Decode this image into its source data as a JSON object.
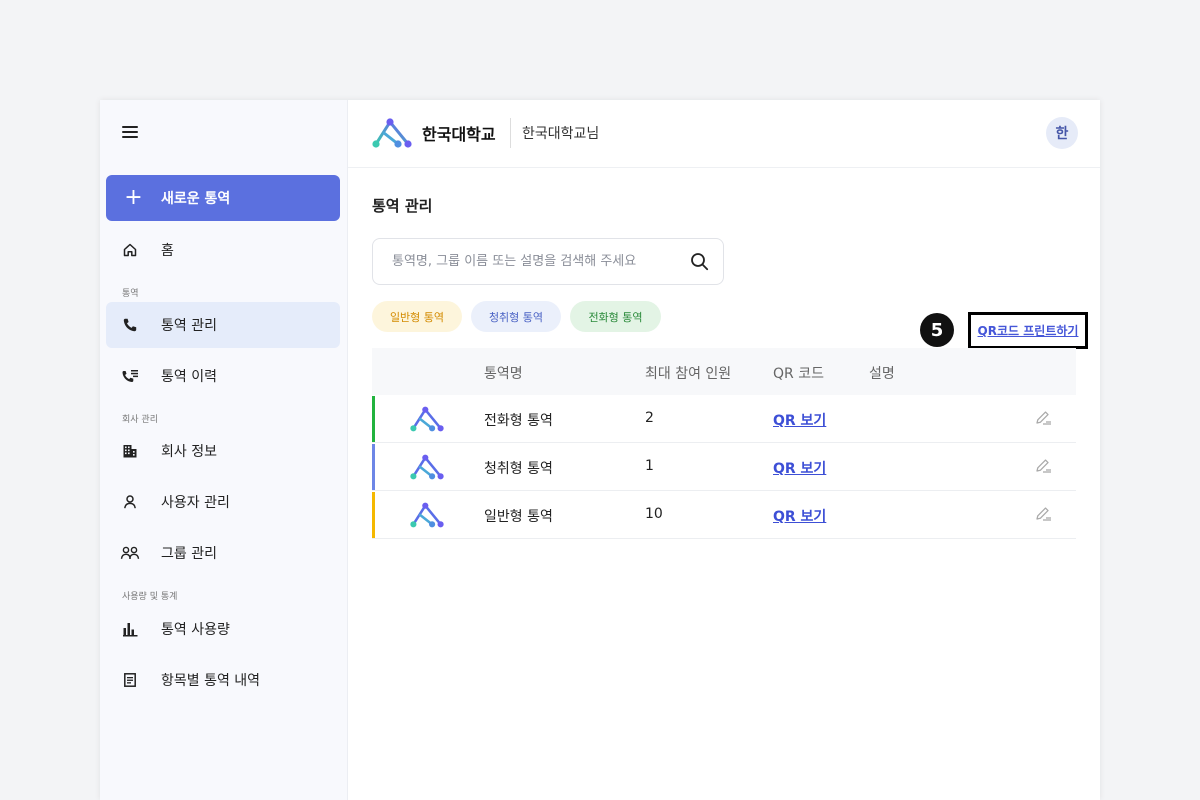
{
  "sidebar": {
    "new_call": "새로운 통역",
    "home": "홈",
    "section_call": "통역",
    "call_manage": "통역 관리",
    "call_history": "통역 이력",
    "section_company": "회사 관리",
    "company_info": "회사 정보",
    "user_manage": "사용자 관리",
    "group_manage": "그룹 관리",
    "section_usage": "사용량 및 통계",
    "usage": "통역 사용량",
    "itemized": "항목별 통역 내역"
  },
  "header": {
    "org_name": "한국대학교",
    "user_name": "한국대학교님",
    "avatar": "한"
  },
  "main": {
    "title": "통역 관리",
    "search_placeholder": "통역명, 그룹 이름 또는 설명을 검색해 주세요",
    "search_value": "",
    "chips": {
      "general": "일반형 통역",
      "listen": "청취형 통역",
      "phone": "전화형 통역"
    },
    "step_badge": "5",
    "qr_print": "QR코드 프린트하기",
    "table": {
      "headers": {
        "name": "통역명",
        "max": "최대 참여 인원",
        "qr": "QR 코드",
        "desc": "설명"
      },
      "rows": [
        {
          "name": "전화형 통역",
          "max": "2",
          "qr": "QR 보기",
          "desc": "",
          "color": "#22b33e"
        },
        {
          "name": "청취형 통역",
          "max": "1",
          "qr": "QR 보기",
          "desc": "",
          "color": "#6d86e6"
        },
        {
          "name": "일반형 통역",
          "max": "10",
          "qr": "QR 보기",
          "desc": "",
          "color": "#f5b800"
        }
      ]
    }
  },
  "colors": {
    "accent": "#5b70df",
    "active_bg": "#e5ecfa",
    "link": "#3d4fd6"
  },
  "icons": [
    "menu-icon",
    "plus-icon",
    "home-icon",
    "phone-icon",
    "call-log-icon",
    "building-icon",
    "user-icon",
    "group-icon",
    "bar-chart-icon",
    "document-icon",
    "search-icon",
    "logo-icon",
    "edit-icon"
  ]
}
